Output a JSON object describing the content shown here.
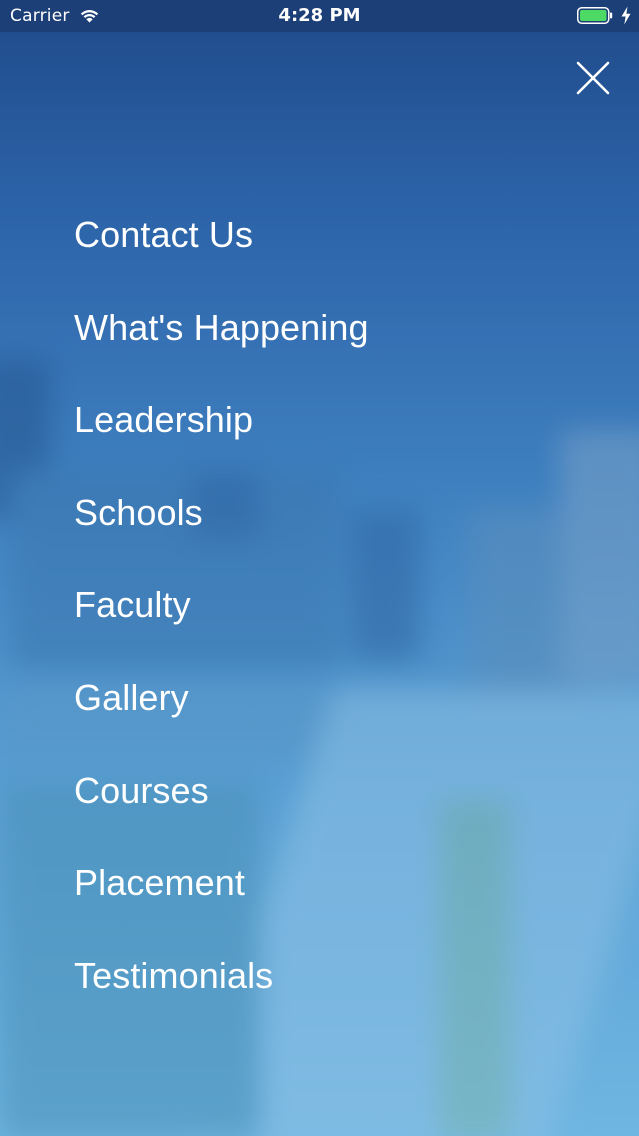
{
  "status_bar": {
    "carrier": "Carrier",
    "time": "4:28 PM",
    "wifi_icon": "wifi-icon",
    "battery_icon": "battery-full-icon",
    "charging_icon": "bolt-icon",
    "battery_color": "#4cd964"
  },
  "header": {
    "close_icon": "close-icon"
  },
  "menu": {
    "items": [
      {
        "label": "Contact Us"
      },
      {
        "label": "What's Happening"
      },
      {
        "label": "Leadership"
      },
      {
        "label": "Schools"
      },
      {
        "label": "Faculty"
      },
      {
        "label": "Gallery"
      },
      {
        "label": "Courses"
      },
      {
        "label": "Placement"
      },
      {
        "label": "Testimonials"
      }
    ]
  },
  "colors": {
    "status_bar_bg": "#1d3f77",
    "overlay_top": "#1f4a8a",
    "overlay_bottom": "#6fb6e2",
    "text": "#ffffff"
  }
}
